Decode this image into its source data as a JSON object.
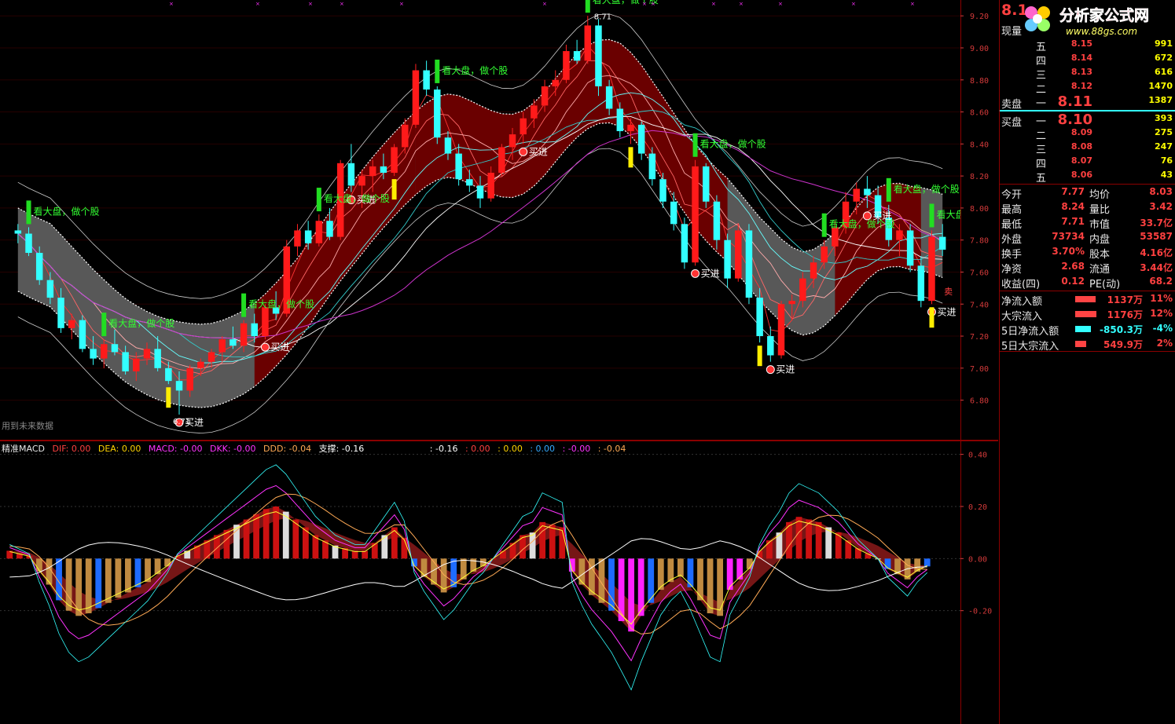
{
  "watermark": {
    "brand": "分析家公式网",
    "url": "www.88gs.com"
  },
  "price_panel": {
    "future_data_note": "用到未来数据",
    "low_marker": "6.71",
    "buy_label": "买进",
    "follow_label": "看大盘，做个股",
    "sell_label": "卖"
  },
  "macd_legend": {
    "name": "精准MACD",
    "dif": "DIF: 0.00",
    "dea": "DEA: 0.00",
    "macd": "MACD: -0.00",
    "dkk": "DKK: -0.00",
    "ddd": "DDD: -0.04",
    "support": "支撑: -0.16",
    "v1": ": -0.16",
    "v2": ": 0.00",
    "v3": ": 0.00",
    "v4": ": 0.00",
    "v5": ": -0.00",
    "v6": ": -0.04"
  },
  "order_book": {
    "current_label": "现量",
    "sell_label": "卖盘",
    "buy_label": "买盘",
    "current_price": "8.1",
    "sell": [
      {
        "level": "五",
        "price": "8.15",
        "vol": "991"
      },
      {
        "level": "四",
        "price": "8.14",
        "vol": "672"
      },
      {
        "level": "三",
        "price": "8.13",
        "vol": "616"
      },
      {
        "level": "二",
        "price": "8.12",
        "vol": "1470"
      },
      {
        "level": "一",
        "price": "8.11",
        "vol": "1387"
      }
    ],
    "buy": [
      {
        "level": "一",
        "price": "8.10",
        "vol": "393"
      },
      {
        "level": "二",
        "price": "8.09",
        "vol": "275"
      },
      {
        "level": "三",
        "price": "8.08",
        "vol": "247"
      },
      {
        "level": "四",
        "price": "8.07",
        "vol": "76"
      },
      {
        "level": "五",
        "price": "8.06",
        "vol": "43"
      }
    ]
  },
  "stats": [
    {
      "l1": "今开",
      "v1": "7.77",
      "l2": "均价",
      "v2": "8.03"
    },
    {
      "l1": "最高",
      "v1": "8.24",
      "l2": "量比",
      "v2": "3.42"
    },
    {
      "l1": "最低",
      "v1": "7.71",
      "l2": "市值",
      "v2": "33.7亿"
    },
    {
      "l1": "外盘",
      "v1": "73734",
      "l2": "内盘",
      "v2": "53587"
    },
    {
      "l1": "换手",
      "v1": "3.70%",
      "l2": "股本",
      "v2": "4.16亿"
    },
    {
      "l1": "净资",
      "v1": "2.68",
      "l2": "流通",
      "v2": "3.44亿"
    },
    {
      "l1": "收益(四)",
      "v1": "0.12",
      "l2": "PE(动)",
      "v2": "68.2"
    }
  ],
  "flows": [
    {
      "label": "净流入额",
      "value": "1137万",
      "pct": "11%",
      "frac": 0.85
    },
    {
      "label": "大宗流入",
      "value": "1176万",
      "pct": "12%",
      "frac": 0.9
    },
    {
      "label": "5日净流入额",
      "value": "-850.3万",
      "pct": "-4%",
      "frac": 0.65
    },
    {
      "label": "5日大宗流入",
      "value": "549.9万",
      "pct": "2%",
      "frac": 0.45
    }
  ],
  "chart_data": [
    {
      "type": "candlestick",
      "title": "",
      "ylim": [
        6.7,
        9.25
      ],
      "y_ticks": [
        "9.20",
        "9.00",
        "8.80",
        "8.60",
        "8.40",
        "8.20",
        "8.00",
        "7.80",
        "7.60",
        "7.40",
        "7.20",
        "7.00",
        "6.80"
      ],
      "annotations": [
        "8.71",
        "6.71"
      ],
      "ohlc": [
        [
          7.86,
          7.9,
          7.78,
          7.84
        ],
        [
          7.84,
          7.88,
          7.7,
          7.72
        ],
        [
          7.72,
          7.76,
          7.52,
          7.55
        ],
        [
          7.55,
          7.6,
          7.4,
          7.44
        ],
        [
          7.44,
          7.5,
          7.22,
          7.25
        ],
        [
          7.25,
          7.34,
          7.18,
          7.3
        ],
        [
          7.3,
          7.33,
          7.1,
          7.12
        ],
        [
          7.12,
          7.2,
          7.02,
          7.06
        ],
        [
          7.06,
          7.18,
          7.0,
          7.15
        ],
        [
          7.15,
          7.24,
          7.08,
          7.1
        ],
        [
          7.1,
          7.14,
          6.96,
          6.98
        ],
        [
          6.98,
          7.1,
          6.92,
          7.06
        ],
        [
          7.06,
          7.16,
          7.02,
          7.12
        ],
        [
          7.12,
          7.2,
          6.98,
          7.0
        ],
        [
          7.0,
          7.04,
          6.9,
          6.92
        ],
        [
          6.92,
          6.98,
          6.71,
          6.86
        ],
        [
          6.86,
          7.02,
          6.82,
          7.0
        ],
        [
          7.0,
          7.06,
          6.95,
          7.04
        ],
        [
          7.04,
          7.12,
          7.0,
          7.1
        ],
        [
          7.1,
          7.2,
          7.04,
          7.18
        ],
        [
          7.18,
          7.26,
          7.12,
          7.14
        ],
        [
          7.14,
          7.3,
          7.1,
          7.28
        ],
        [
          7.28,
          7.34,
          7.16,
          7.2
        ],
        [
          7.2,
          7.4,
          7.18,
          7.38
        ],
        [
          7.38,
          7.48,
          7.3,
          7.34
        ],
        [
          7.34,
          7.8,
          7.32,
          7.76
        ],
        [
          7.76,
          7.9,
          7.7,
          7.86
        ],
        [
          7.86,
          7.92,
          7.74,
          7.78
        ],
        [
          7.78,
          7.96,
          7.76,
          7.92
        ],
        [
          7.92,
          8.0,
          7.8,
          7.82
        ],
        [
          7.82,
          8.3,
          7.8,
          8.28
        ],
        [
          8.28,
          8.4,
          8.1,
          8.14
        ],
        [
          8.14,
          8.24,
          8.0,
          8.2
        ],
        [
          8.2,
          8.3,
          8.1,
          8.26
        ],
        [
          8.26,
          8.34,
          8.18,
          8.22
        ],
        [
          8.22,
          8.4,
          8.2,
          8.38
        ],
        [
          8.38,
          8.56,
          8.34,
          8.52
        ],
        [
          8.52,
          8.9,
          8.5,
          8.86
        ],
        [
          8.86,
          8.92,
          8.7,
          8.74
        ],
        [
          8.74,
          8.76,
          8.4,
          8.44
        ],
        [
          8.44,
          8.48,
          8.3,
          8.34
        ],
        [
          8.34,
          8.4,
          8.14,
          8.18
        ],
        [
          8.18,
          8.24,
          8.1,
          8.14
        ],
        [
          8.14,
          8.2,
          8.0,
          8.06
        ],
        [
          8.06,
          8.26,
          8.04,
          8.22
        ],
        [
          8.22,
          8.4,
          8.2,
          8.38
        ],
        [
          8.38,
          8.5,
          8.3,
          8.46
        ],
        [
          8.46,
          8.6,
          8.4,
          8.56
        ],
        [
          8.56,
          8.68,
          8.5,
          8.64
        ],
        [
          8.64,
          8.8,
          8.6,
          8.76
        ],
        [
          8.76,
          8.86,
          8.7,
          8.8
        ],
        [
          8.8,
          9.02,
          8.78,
          8.98
        ],
        [
          8.98,
          9.05,
          8.9,
          8.92
        ],
        [
          8.92,
          9.2,
          8.9,
          9.14
        ],
        [
          9.14,
          9.18,
          8.7,
          8.76
        ],
        [
          8.76,
          8.8,
          8.58,
          8.62
        ],
        [
          8.62,
          8.66,
          8.44,
          8.48
        ],
        [
          8.48,
          8.56,
          8.4,
          8.52
        ],
        [
          8.52,
          8.54,
          8.3,
          8.34
        ],
        [
          8.34,
          8.38,
          8.14,
          8.18
        ],
        [
          8.18,
          8.22,
          8.0,
          8.04
        ],
        [
          8.04,
          8.1,
          7.86,
          7.9
        ],
        [
          7.9,
          7.94,
          7.62,
          7.66
        ],
        [
          7.66,
          8.3,
          7.64,
          8.26
        ],
        [
          8.26,
          8.28,
          8.0,
          8.04
        ],
        [
          8.04,
          8.08,
          7.74,
          7.8
        ],
        [
          7.8,
          7.84,
          7.5,
          7.56
        ],
        [
          7.56,
          7.9,
          7.54,
          7.86
        ],
        [
          7.86,
          7.9,
          7.4,
          7.44
        ],
        [
          7.44,
          7.5,
          7.16,
          7.2
        ],
        [
          7.2,
          7.26,
          7.04,
          7.08
        ],
        [
          7.08,
          7.42,
          7.06,
          7.4
        ],
        [
          7.4,
          7.46,
          7.3,
          7.42
        ],
        [
          7.42,
          7.6,
          7.38,
          7.56
        ],
        [
          7.56,
          7.7,
          7.5,
          7.66
        ],
        [
          7.66,
          7.8,
          7.62,
          7.76
        ],
        [
          7.76,
          7.92,
          7.7,
          7.88
        ],
        [
          7.88,
          8.1,
          7.84,
          8.04
        ],
        [
          8.04,
          8.16,
          7.96,
          8.12
        ],
        [
          8.12,
          8.2,
          8.0,
          8.08
        ],
        [
          8.08,
          8.14,
          7.9,
          7.94
        ],
        [
          7.94,
          8.02,
          7.76,
          7.8
        ],
        [
          7.8,
          7.9,
          7.7,
          7.86
        ],
        [
          7.86,
          7.9,
          7.6,
          7.64
        ],
        [
          7.64,
          7.7,
          7.38,
          7.42
        ],
        [
          7.42,
          7.86,
          7.4,
          7.82
        ],
        [
          7.82,
          7.9,
          7.7,
          7.74
        ]
      ]
    },
    {
      "type": "bar",
      "title": "精准MACD",
      "ylim": [
        -0.62,
        0.42
      ],
      "y_ticks": [
        "0.40",
        "0.20",
        "0.00",
        "-0.20"
      ],
      "series": [
        {
          "name": "MACD",
          "values": [
            0.03,
            0.02,
            0.01,
            -0.05,
            -0.1,
            -0.16,
            -0.2,
            -0.22,
            -0.21,
            -0.19,
            -0.17,
            -0.15,
            -0.13,
            -0.11,
            -0.09,
            -0.06,
            -0.03,
            0.01,
            0.03,
            0.05,
            0.07,
            0.09,
            0.11,
            0.13,
            0.15,
            0.17,
            0.19,
            0.2,
            0.18,
            0.15,
            0.12,
            0.09,
            0.07,
            0.05,
            0.04,
            0.03,
            0.03,
            0.06,
            0.09,
            0.12,
            0.08,
            -0.03,
            -0.07,
            -0.1,
            -0.13,
            -0.11,
            -0.08,
            -0.05,
            -0.03,
            0.0,
            0.03,
            0.06,
            0.09,
            0.1,
            0.14,
            0.13,
            0.12,
            -0.05,
            -0.1,
            -0.14,
            -0.17,
            -0.2,
            -0.24,
            -0.28,
            -0.22,
            -0.17,
            -0.12,
            -0.09,
            -0.07,
            -0.11,
            -0.16,
            -0.21,
            -0.22,
            -0.12,
            -0.08,
            -0.04,
            0.03,
            0.07,
            0.1,
            0.14,
            0.16,
            0.15,
            0.14,
            0.12,
            0.1,
            0.07,
            0.04,
            0.02,
            0.0,
            -0.04,
            -0.06,
            -0.08,
            -0.05,
            -0.03
          ]
        }
      ]
    }
  ]
}
